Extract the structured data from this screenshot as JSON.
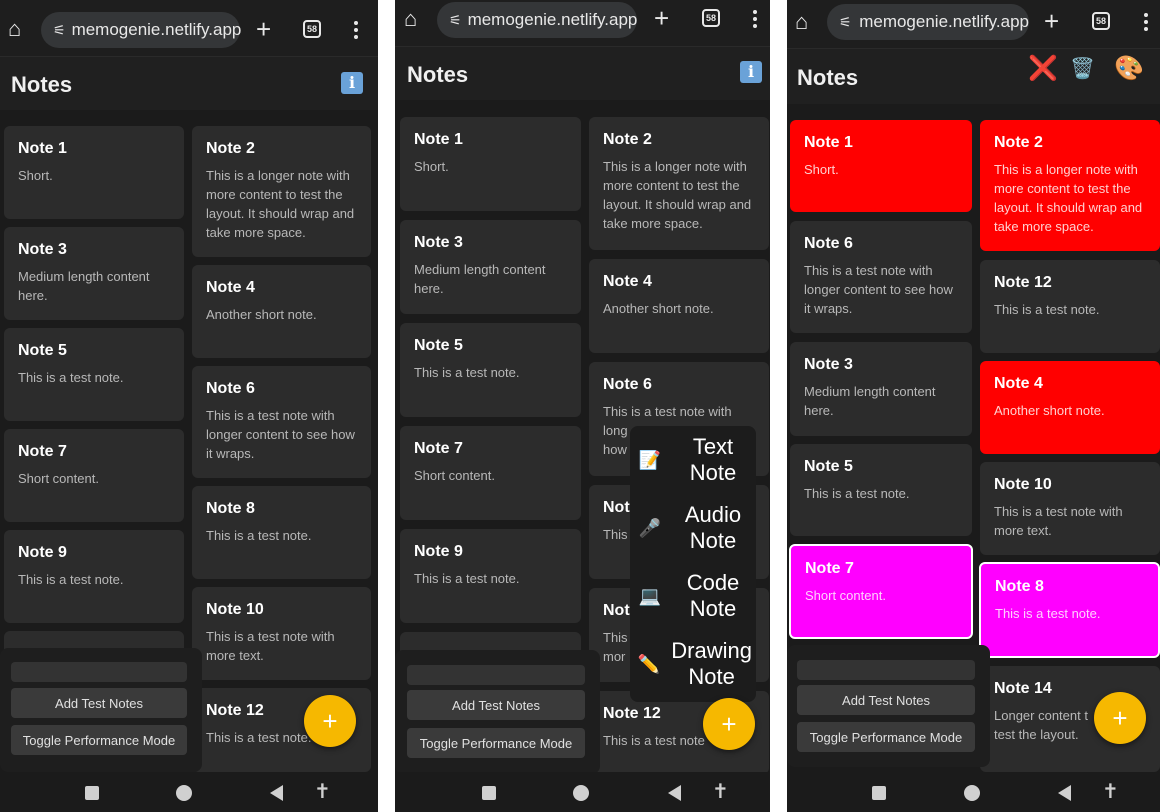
{
  "browser": {
    "url": "memogenie.netlify.app",
    "tab_count": "58",
    "home_glyph": "⌂",
    "tune_glyph": "⚟",
    "new_tab_glyph": "+"
  },
  "app": {
    "title": "Notes",
    "info_glyph": "i",
    "fab_label": "+",
    "add_test_notes": "Add Test Notes",
    "toggle_perf": "Toggle Performance Mode",
    "accessibility_glyph": "✝"
  },
  "notes": {
    "n1": {
      "title": "Note 1",
      "body": "Short."
    },
    "n2": {
      "title": "Note 2",
      "body": "This is a longer note with more content to test the layout. It should wrap and take more space."
    },
    "n3": {
      "title": "Note 3",
      "body": "Medium length content here."
    },
    "n4": {
      "title": "Note 4",
      "body": "Another short note."
    },
    "n5": {
      "title": "Note 5",
      "body": "This is a test note."
    },
    "n6": {
      "title": "Note 6",
      "body": "This is a test note with longer content to see how it wraps."
    },
    "n7": {
      "title": "Note 7",
      "body": "Short content."
    },
    "n8": {
      "title": "Note 8",
      "body": "This is a test note."
    },
    "n9": {
      "title": "Note 9",
      "body": "This is a test note."
    },
    "n10": {
      "title": "Note 10",
      "body": "This is a test note with more text."
    },
    "n12": {
      "title": "Note 12",
      "body": "This is a test note."
    },
    "n14": {
      "title": "Note 14",
      "body": "Longer content to test the layout."
    }
  },
  "partial": {
    "n6_line1": "This is a test note with",
    "n6_line2": "long",
    "n6_line3": "how",
    "n8_title": "Not",
    "n8_body": "This",
    "n10_title": "Not",
    "n10_line1": "This",
    "n10_line2": "mor",
    "n12_body": "This is a test note",
    "n14_line1": "Longer content t",
    "n14_line2": "test the layout."
  },
  "new_note_menu": [
    {
      "icon": "📝",
      "icon_name": "memo-icon",
      "label": "Text Note"
    },
    {
      "icon": "🎤",
      "icon_name": "microphone-icon",
      "label": "Audio Note"
    },
    {
      "icon": "💻",
      "icon_name": "laptop-icon",
      "label": "Code Note"
    },
    {
      "icon": "✏️",
      "icon_name": "pencil-icon",
      "label": "Drawing Note"
    }
  ],
  "selection_toolbar": {
    "close_glyph": "❌",
    "delete_glyph": "🗑️",
    "color_glyph": "🎨"
  },
  "colors": {
    "selected_red": "#ff0000",
    "selected_magenta": "#ff00ff",
    "fab": "#f6b800",
    "card": "#2c2c2c",
    "background": "#1b1b1b"
  }
}
